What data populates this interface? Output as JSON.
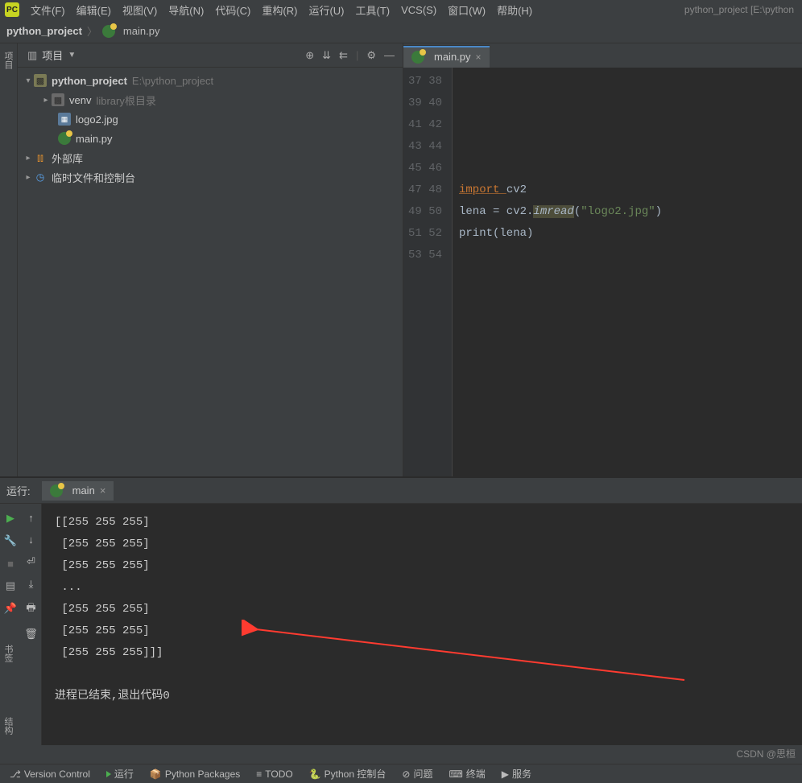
{
  "menu": {
    "items": [
      "文件(F)",
      "编辑(E)",
      "视图(V)",
      "导航(N)",
      "代码(C)",
      "重构(R)",
      "运行(U)",
      "工具(T)",
      "VCS(S)",
      "窗口(W)",
      "帮助(H)"
    ],
    "project_label": "python_project [E:\\python"
  },
  "breadcrumb": {
    "project": "python_project",
    "file": "main.py"
  },
  "project_panel": {
    "title": "项目",
    "root": {
      "name": "python_project",
      "path": "E:\\python_project"
    },
    "venv": {
      "name": "venv",
      "suffix": "library根目录"
    },
    "files": [
      "logo2.jpg",
      "main.py"
    ],
    "external": "外部库",
    "scratch": "临时文件和控制台"
  },
  "editor": {
    "tab": "main.py",
    "line_start": 37,
    "line_end": 54,
    "code_lines": [
      "",
      "",
      "",
      "",
      "",
      {
        "type": "import",
        "kw": "import",
        "mod": "cv2"
      },
      {
        "type": "assign",
        "text_pre": "lena = cv2.",
        "fn": "imread",
        "args_open": "(",
        "str": "\"logo2.jpg\"",
        "args_close": ")"
      },
      {
        "type": "call",
        "text": "print(lena)"
      },
      "",
      "",
      "",
      "",
      "",
      "",
      "",
      "",
      "",
      ""
    ]
  },
  "run": {
    "label": "运行:",
    "tab": "main",
    "output": [
      "[[255 255 255]",
      " [255 255 255]",
      " [255 255 255]",
      " ...",
      " [255 255 255]",
      " [255 255 255]",
      " [255 255 255]]]",
      "",
      "进程已结束,退出代码0"
    ]
  },
  "status": {
    "items": [
      "Version Control",
      "运行",
      "Python Packages",
      "TODO",
      "Python 控制台",
      "问题",
      "终端",
      "服务"
    ]
  },
  "left_tabs": {
    "bookmark": "书签",
    "structure": "结构"
  },
  "watermark": "CSDN @思桓"
}
